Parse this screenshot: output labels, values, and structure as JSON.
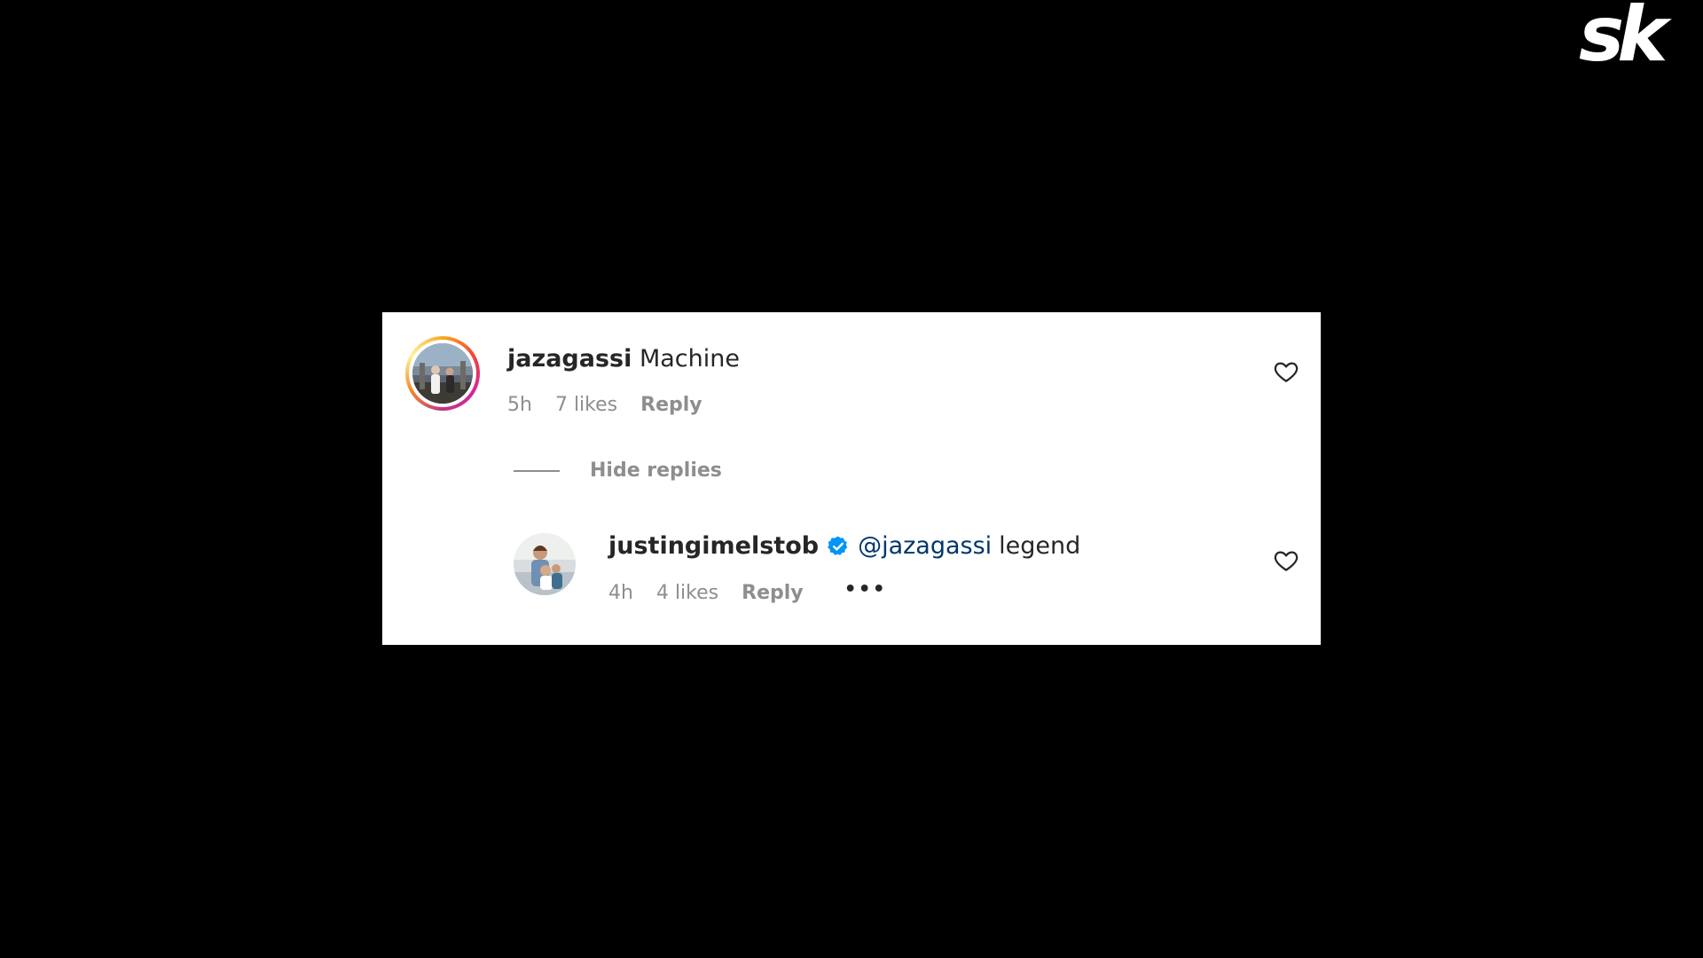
{
  "brand": {
    "logo_text": "sk",
    "logo_color": "#ffffff"
  },
  "comment": {
    "username": "jazagassi",
    "text": "Machine",
    "time": "5h",
    "likes": "7 likes",
    "reply_label": "Reply",
    "avatar_icon": "user-avatar-icon",
    "like_icon": "heart-outline-icon"
  },
  "thread": {
    "hide_replies_label": "Hide replies"
  },
  "reply": {
    "username": "justingimelstob",
    "verified_icon": "verified-badge-icon",
    "mention": "@jazagassi",
    "text": "legend",
    "time": "4h",
    "likes": "4 likes",
    "reply_label": "Reply",
    "more_label": "•••",
    "avatar_icon": "user-avatar-icon",
    "like_icon": "heart-outline-icon"
  },
  "colors": {
    "background": "#000000",
    "card": "#ffffff",
    "text_primary": "#262626",
    "text_secondary": "#8e8e8e",
    "mention": "#00376b",
    "verified": "#0095f6"
  }
}
